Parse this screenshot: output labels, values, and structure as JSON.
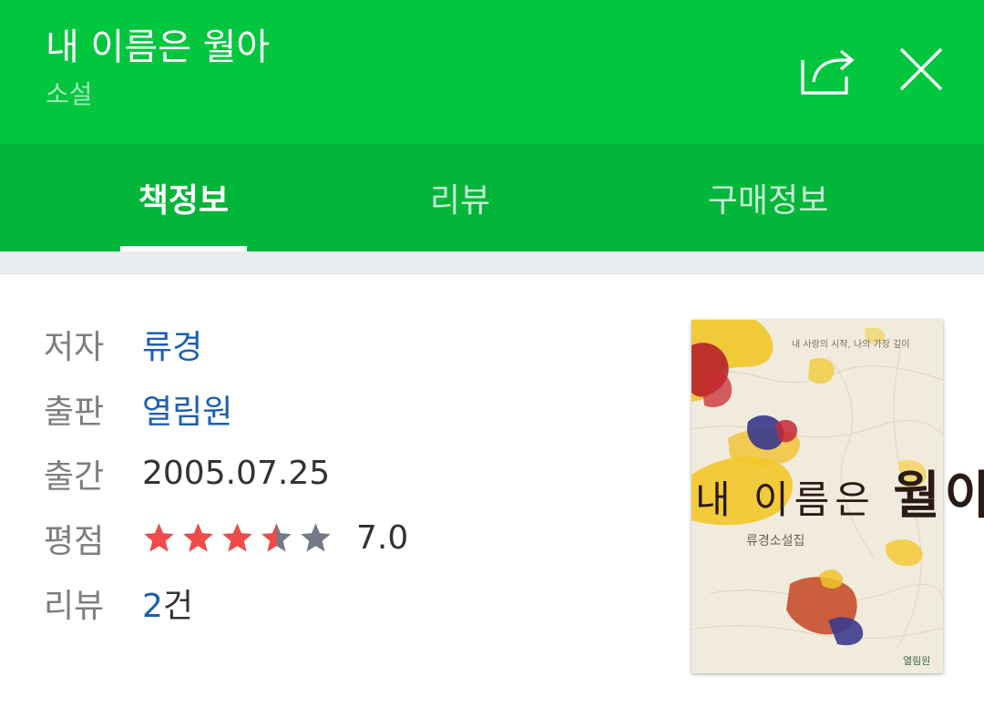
{
  "header": {
    "title": "내 이름은 월아",
    "category": "소설",
    "share_icon": "share-icon",
    "close_icon": "close-icon",
    "bg_color": "#03c63f"
  },
  "tabs": [
    {
      "label": "책정보",
      "active": true
    },
    {
      "label": "리뷰",
      "active": false
    },
    {
      "label": "구매정보",
      "active": false
    }
  ],
  "info": {
    "author_label": "저자",
    "author": "류경",
    "publisher_label": "출판",
    "publisher": "열림원",
    "date_label": "출간",
    "date": "2005.07.25",
    "rating_label": "평점",
    "rating_value": "7.0",
    "rating_stars": 3.5,
    "rating_max_stars": 5,
    "review_label": "리뷰",
    "review_count": "2",
    "review_unit": "건"
  },
  "cover": {
    "title_small": "내 이름은",
    "title_big": "월아",
    "top_text": "내 사랑의 시작, 나의 가장 깊이",
    "subtitle": "류경소설집",
    "publisher": "열림원"
  },
  "colors": {
    "link": "#1a5fb4",
    "star_filled": "#ef4b4b",
    "star_empty": "#737a86"
  }
}
